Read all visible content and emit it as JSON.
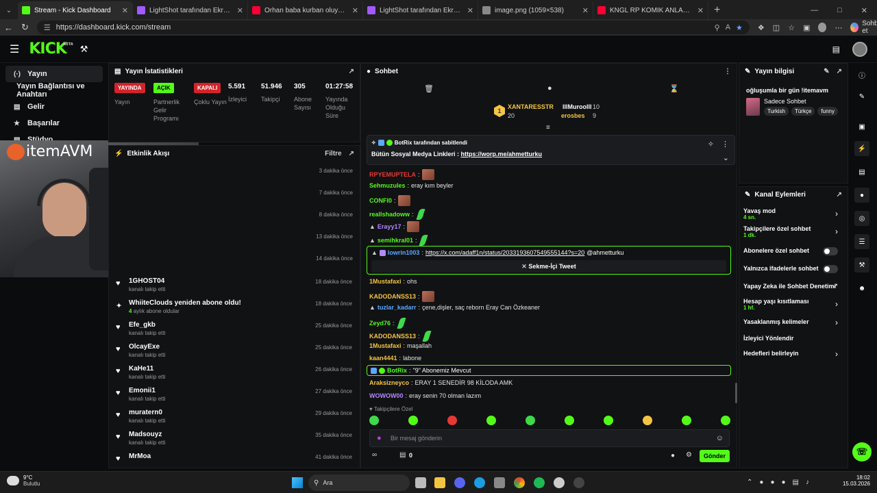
{
  "browser": {
    "tabs": [
      {
        "title": "Stream - Kick Dashboard",
        "color": "#53fc18",
        "active": true
      },
      {
        "title": "LightShot tarafından Ekran Görünü",
        "color": "#a259ff",
        "active": false
      },
      {
        "title": "Orhan baba kurban oluyum dişler",
        "color": "#ff0033",
        "active": false
      },
      {
        "title": "LightShot tarafından Ekran Görünü",
        "color": "#a259ff",
        "active": false
      },
      {
        "title": "image.png (1059×538)",
        "color": "#888888",
        "active": false
      },
      {
        "title": "KNGL RP KOMİK ANLAR #6 (GÜNÜ",
        "color": "#ff0033",
        "active": false
      }
    ],
    "url": "https://dashboard.kick.com/stream",
    "profile_label": "Sohbet et"
  },
  "sidebar": {
    "items": [
      {
        "label": "Yayın",
        "icon": "(·)",
        "active": true
      },
      {
        "label": "Yayın Bağlantısı ve Anahtarı",
        "icon": "",
        "active": false,
        "sub": true
      },
      {
        "label": "Gelir",
        "icon": "▤",
        "active": false
      },
      {
        "label": "Başarılar",
        "icon": "★",
        "active": false
      },
      {
        "label": "Stüdyo",
        "icon": "▤",
        "active": false
      },
      {
        "label": "Denetleme",
        "icon": "⚑",
        "active": false
      }
    ],
    "overlay_brand": "itemAVM"
  },
  "stats": {
    "title": "Yayın İstatistikleri",
    "items": [
      {
        "badge": "YAYINDA",
        "badge_color": "#d4232a",
        "label": "Yayın"
      },
      {
        "badge": "AÇIK",
        "badge_color": "#53fc18",
        "label": "Partnerlik Gelir Programı"
      },
      {
        "badge": "KAPALI",
        "badge_color": "#d4232a",
        "label": "Çoklu Yayın"
      },
      {
        "value": "5.591",
        "label": "İzleyici"
      },
      {
        "value": "51.946",
        "label": "Takipçi"
      },
      {
        "value": "305",
        "label": "Abone Sayısı"
      },
      {
        "value": "01:27:58",
        "label": "Yayında Olduğu Süre"
      }
    ]
  },
  "activity": {
    "title": "Etkinlik Akışı",
    "filter_label": "Filtre",
    "hidden_times": [
      "3 dakika önce",
      "7 dakika önce",
      "8 dakika önce",
      "13 dakika önce",
      "14 dakika önce"
    ],
    "events": [
      {
        "name": "1GHOST04",
        "sub": "kanalı takip etti",
        "time": "18 dakika önce",
        "icon": "heart"
      },
      {
        "name": "WhiiteClouds yeniden abone oldu!",
        "sub_num": "4",
        "sub": "aylık abone oldular",
        "time": "18 dakika önce",
        "icon": "star"
      },
      {
        "name": "Efe_gkb",
        "sub": "kanalı takip etti",
        "time": "25 dakika önce",
        "icon": "heart"
      },
      {
        "name": "OlcayExe",
        "sub": "kanalı takip etti",
        "time": "25 dakika önce",
        "icon": "heart"
      },
      {
        "name": "KaHe11",
        "sub": "kanalı takip etti",
        "time": "26 dakika önce",
        "icon": "heart"
      },
      {
        "name": "Emonii1",
        "sub": "kanalı takip etti",
        "time": "27 dakika önce",
        "icon": "heart"
      },
      {
        "name": "muratern0",
        "sub": "kanalı takip etti",
        "time": "29 dakika önce",
        "icon": "heart"
      },
      {
        "name": "Madsouyz",
        "sub": "kanalı takip etti",
        "time": "35 dakika önce",
        "icon": "heart"
      },
      {
        "name": "MrMoa",
        "sub": "",
        "time": "41 dakika önce",
        "icon": "heart"
      }
    ]
  },
  "chat": {
    "title": "Sohbet",
    "leaderboard": [
      {
        "name": "XANTARESSTR",
        "score": "20",
        "rank": "1",
        "color": "#f5c542"
      },
      {
        "name": "lllMuroolll",
        "score": "10",
        "color": "#ffffff"
      },
      {
        "name": "erosbes",
        "score": "9",
        "color": "#f5c542"
      }
    ],
    "pinned": {
      "by": "BotRix tarafından sabitlendi",
      "text": "Bütün Sosyal Medya Linkleri : ",
      "link": "https://worp.me/ahmetturku"
    },
    "messages": [
      {
        "user": "RPYEMUPTELA",
        "color": "#e53935",
        "text": "",
        "emote": "face"
      },
      {
        "user": "Sehmuzules",
        "color": "#53fc18",
        "text": "eray kım beyler",
        "emote": ""
      },
      {
        "user": "CONFI0",
        "color": "#53fc18",
        "text": "",
        "emote": "face"
      },
      {
        "user": "reallshadoww",
        "color": "#53fc18",
        "text": "",
        "emote": "dance"
      },
      {
        "user": "Erayy17",
        "color": "#b388ff",
        "text": "",
        "emote": "face",
        "badge": true
      },
      {
        "user": "semihkral01",
        "color": "#53fc18",
        "text": "",
        "emote": "dance",
        "badge": true
      }
    ],
    "tweet": {
      "user": "lowrin1003",
      "link": "https://x.com/adaff1n/status/2033193607549555144?s=20",
      "mention": "@ahmetturku",
      "button": "Sekme-İçi Tweet"
    },
    "messages2": [
      {
        "user": "1Mustafaxi",
        "color": "#f5c542",
        "text": "ohs",
        "emote": ""
      },
      {
        "user": "KADODANSS13",
        "color": "#f5c542",
        "text": "",
        "emote": "face"
      },
      {
        "user": "tuzlar_kadarr",
        "color": "#5aa9ff",
        "text": "çene,dişler, saç reborn Eray Can Özkeaner",
        "emote": "",
        "badge": true
      },
      {
        "user": "Zeyd76",
        "color": "#53fc18",
        "text": "",
        "emote": "dance"
      },
      {
        "user": "KADODANSS13",
        "color": "#f5c542",
        "text": "",
        "emote": "dance"
      },
      {
        "user": "1Mustafaxi",
        "color": "#f5c542",
        "text": "maşallah",
        "emote": ""
      },
      {
        "user": "kaan4441",
        "color": "#f5c542",
        "text": "labone",
        "emote": ""
      }
    ],
    "botmsg": {
      "user": "BotRix",
      "text": "\"9\" Abonemiz Mevcut"
    },
    "messages3": [
      {
        "user": "Araksizneyco",
        "color": "#f5c542",
        "text": "ERAY 1 SENEDİR 98 KİLODA AMK"
      },
      {
        "user": "WOWOW00",
        "color": "#b388ff",
        "text": "eray senin 70 olman lazım"
      }
    ],
    "mode_label": "Takipçilere Özel",
    "placeholder": "Bir mesaj gönderin",
    "points": "0",
    "send_label": "Gönder"
  },
  "stream_info": {
    "title": "Yayın bilgisi",
    "stream_title": "oğluşumla bir gün !itemavm",
    "category": "Sadece Sohbet",
    "tags": [
      "Turkish",
      "Türkçe",
      "funny"
    ]
  },
  "channel_actions": {
    "title": "Kanal Eylemleri",
    "items": [
      {
        "label": "Yavaş mod",
        "sub": "4 sn.",
        "control": "chevron"
      },
      {
        "label": "Takipçilere özel sohbet",
        "sub": "1 dk.",
        "control": "chevron"
      },
      {
        "label": "Abonelere özel sohbet",
        "sub": "",
        "control": "toggle"
      },
      {
        "label": "Yalnızca ifadelerle sohbet",
        "sub": "",
        "control": "toggle"
      },
      {
        "label": "Yapay Zeka ile Sohbet Denetimi",
        "sub": "",
        "control": "external"
      },
      {
        "label": "Hesap yaşı kısıtlaması",
        "sub": "1 hf.",
        "control": "chevron"
      },
      {
        "label": "Yasaklanmış kelimeler",
        "sub": "",
        "control": "chevron"
      },
      {
        "label": "İzleyici Yönlendir",
        "sub": "",
        "control": "none"
      },
      {
        "label": "Hedefleri belirleyin",
        "sub": "",
        "control": "chevron"
      }
    ]
  },
  "taskbar": {
    "weather_temp": "9°C",
    "weather_desc": "Bulutlu",
    "search": "Ara",
    "time": "18:02",
    "date": "15.03.2026"
  },
  "colors": {
    "accent": "#53fc18",
    "live": "#d4232a"
  }
}
